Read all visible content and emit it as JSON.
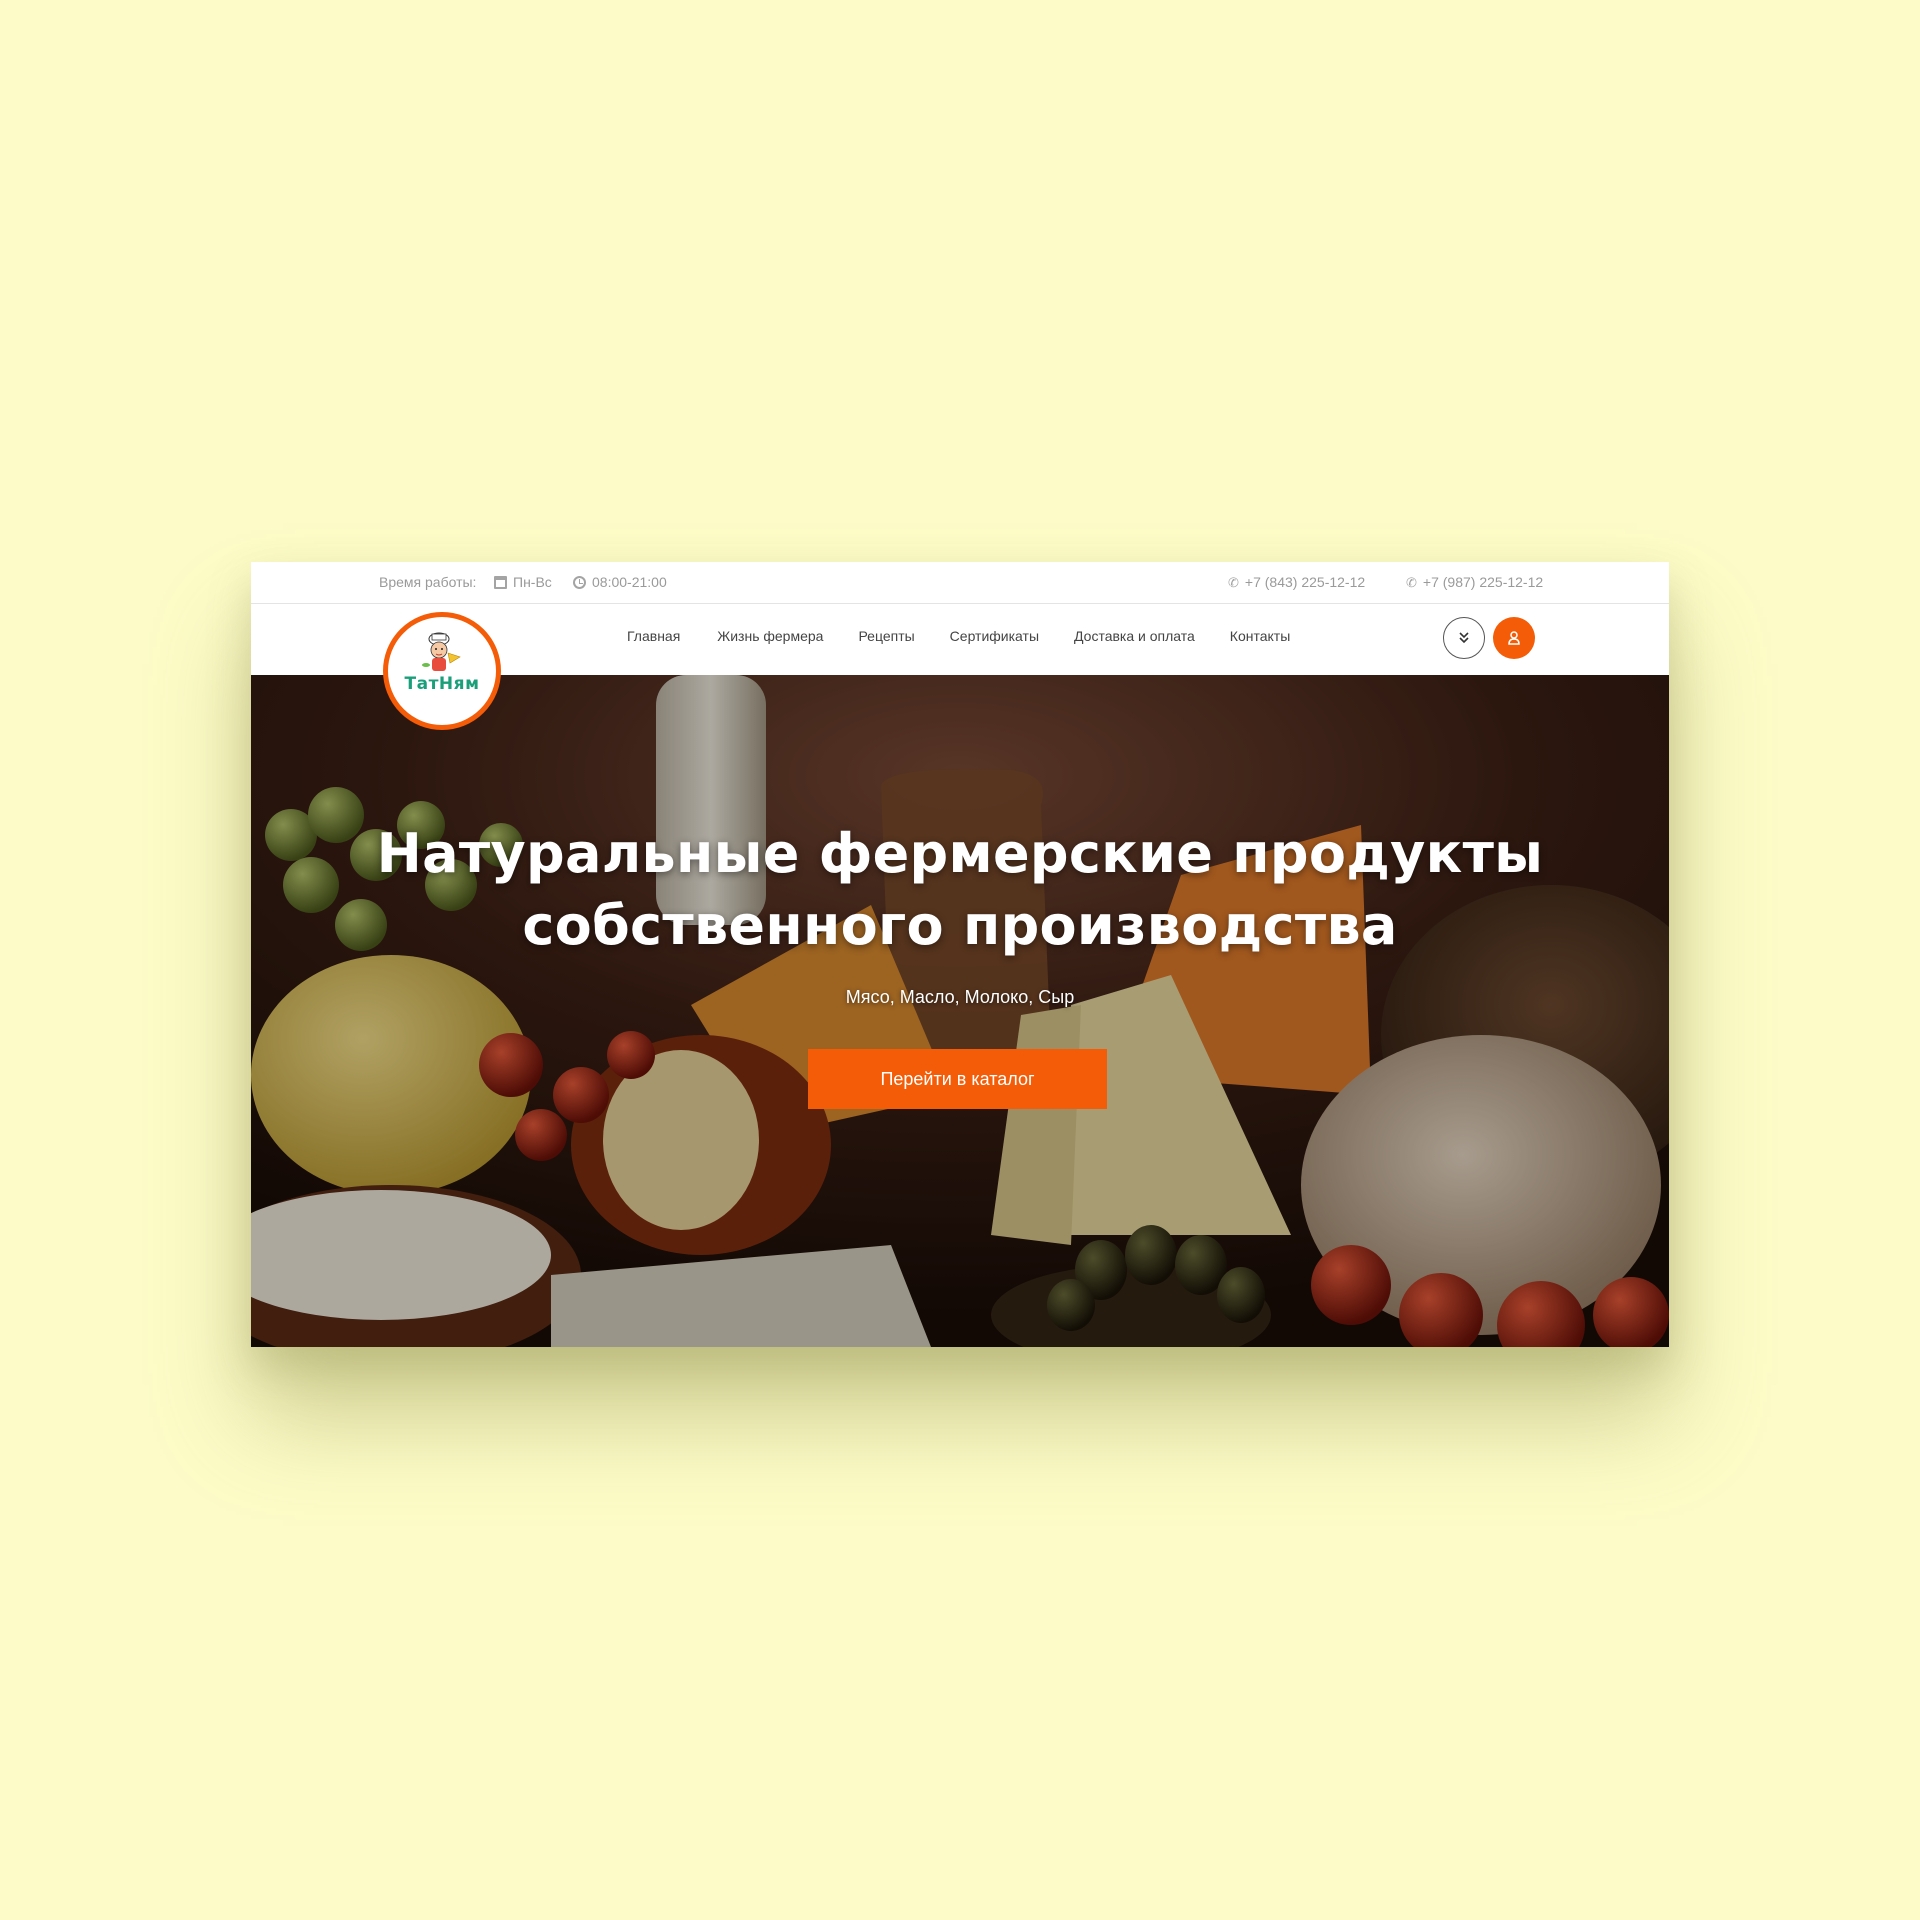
{
  "topbar": {
    "hours_label": "Время работы:",
    "days": "Пн-Вс",
    "time": "08:00-21:00",
    "phone_1": "+7 (843) 225-12-12",
    "phone_2": "+7 (987) 225-12-12"
  },
  "logo": {
    "text": "ТатНям"
  },
  "nav": {
    "items": [
      {
        "label": "Главная"
      },
      {
        "label": "Жизнь фермера"
      },
      {
        "label": "Рецепты"
      },
      {
        "label": "Сертификаты"
      },
      {
        "label": "Доставка и оплата"
      },
      {
        "label": "Контакты"
      }
    ]
  },
  "hero": {
    "title_line_1": "Натуральные фермерские продукты",
    "title_line_2": "собственного производства",
    "subtitle": "Мясо, Масло, Молоко, Сыр",
    "cta_label": "Перейти в каталог"
  },
  "colors": {
    "accent": "#f45c07",
    "page_bg": "#fdfcc8",
    "logo_text": "#1b9f7a"
  },
  "icons": {
    "calendar": "calendar-icon",
    "clock": "clock-icon",
    "phone": "phone-icon",
    "chevrons": "double-chevron-down-icon",
    "user": "user-icon"
  }
}
